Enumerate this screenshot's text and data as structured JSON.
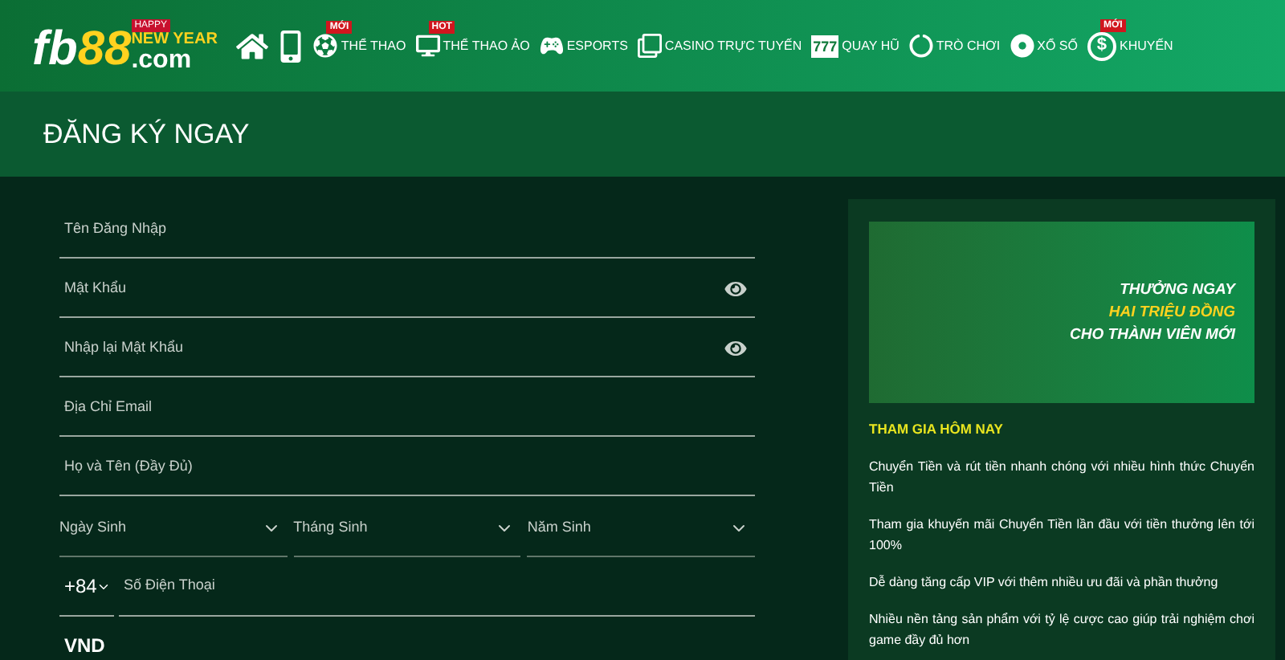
{
  "logo": {
    "part_1": "fb",
    "part_2": "88",
    "part_3": ".com",
    "badge_top": "HAPPY",
    "badge": "NEW YEAR"
  },
  "nav": [
    {
      "kind": "home"
    },
    {
      "kind": "phone"
    },
    {
      "kind": "ball",
      "label": "THỂ THAO",
      "badge": "MỚI"
    },
    {
      "kind": "screen",
      "label": "THỂ THAO ẢO",
      "badge": "HOT"
    },
    {
      "kind": "gamepad",
      "label": "ESPORTS"
    },
    {
      "kind": "cards",
      "label": "CASINO TRỰC TUYẾN"
    },
    {
      "kind": "slot",
      "label": "QUAY HŨ",
      "icon_text": "777"
    },
    {
      "kind": "circle",
      "label": "TRÒ CHƠI"
    },
    {
      "kind": "balls",
      "label": "XỔ SỐ"
    },
    {
      "kind": "coin",
      "label": "KHUYẾN",
      "badge": "MỚI",
      "icon_text": "$"
    }
  ],
  "page_title": "ĐĂNG KÝ NGAY",
  "fields": [
    {
      "kind": "text",
      "placeholder": "Tên Đăng Nhập"
    },
    {
      "kind": "password",
      "placeholder": "Mật Khẩu"
    },
    {
      "kind": "password",
      "placeholder": "Nhập lại Mật Khẩu"
    },
    {
      "kind": "text",
      "placeholder": "Địa Chỉ Email"
    },
    {
      "kind": "text",
      "placeholder": "Họ và Tên (Đầy Đủ)"
    }
  ],
  "birth_selects": [
    "Ngày Sinh",
    "Tháng Sinh",
    "Năm Sinh"
  ],
  "phone": {
    "code": "+84",
    "placeholder": "Số Điện Thoại"
  },
  "currency": "VND",
  "promo": {
    "banner_lines": [
      "THƯỞNG NGAY",
      "HAI TRIỆU ĐỒNG",
      "CHO THÀNH VIÊN MỚI"
    ],
    "heading": "THAM GIA HÔM NAY",
    "paragraphs": [
      "Chuyển Tiền và rút tiền nhanh chóng với nhiều hình thức Chuyển Tiền",
      "Tham gia khuyến mãi Chuyển Tiền lần đầu với tiền thưởng lên tới 100%",
      "Dễ dàng tăng cấp VIP với thêm nhiều ưu đãi và phần thưởng",
      "Nhiều nền tảng sản phẩm với tỷ lệ cược cao giúp trải nghiệm chơi game đầy đủ hơn"
    ]
  }
}
